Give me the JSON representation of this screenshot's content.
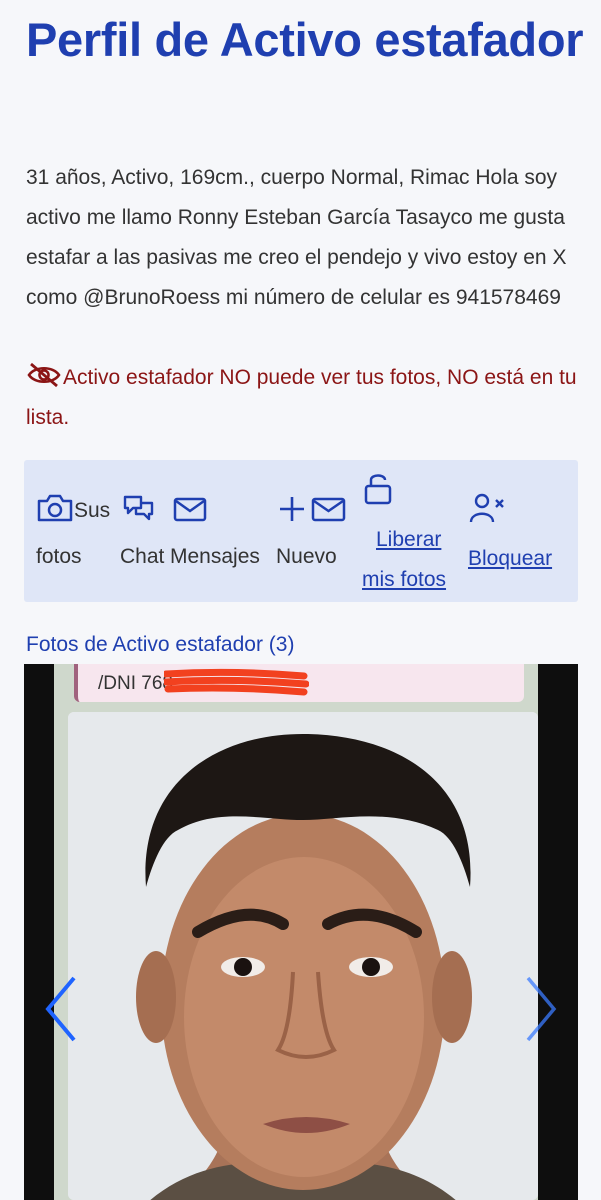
{
  "profile": {
    "title": "Perfil de Activo estafador",
    "description": "31 años, Activo, 169cm., cuerpo Normal, Rimac Hola soy activo me llamo Ronny Esteban García Tasayco me gusta estafar a las pasivas me creo el pendejo y vivo estoy en X como @BrunoRoess mi número de celular es 941578469",
    "notice": "Activo estafador NO puede ver tus fotos, NO está en tu lista.",
    "notice_icon": "eye-slash-icon"
  },
  "actions": {
    "photos_line1": "Sus",
    "photos_line2": "fotos",
    "chat": "Chat",
    "messages": "Mensajes",
    "new": "Nuevo",
    "release_line1": "Liberar",
    "release_line2": "mis fotos",
    "block": "Bloquear",
    "icons": [
      "camera-icon",
      "chat-icon",
      "mail-icon",
      "plus-mail-icon",
      "unlock-icon",
      "user-block-icon"
    ]
  },
  "gallery": {
    "title": "Fotos de Activo estafador (3)",
    "dni_text": "/DNI 768",
    "prev_icon": "chevron-left-icon",
    "next_icon": "chevron-right-icon"
  },
  "colors": {
    "title": "#1f3fb0",
    "notice": "#8b1515",
    "action_bg": "#dfe6f7",
    "link": "#1f3fb0"
  }
}
